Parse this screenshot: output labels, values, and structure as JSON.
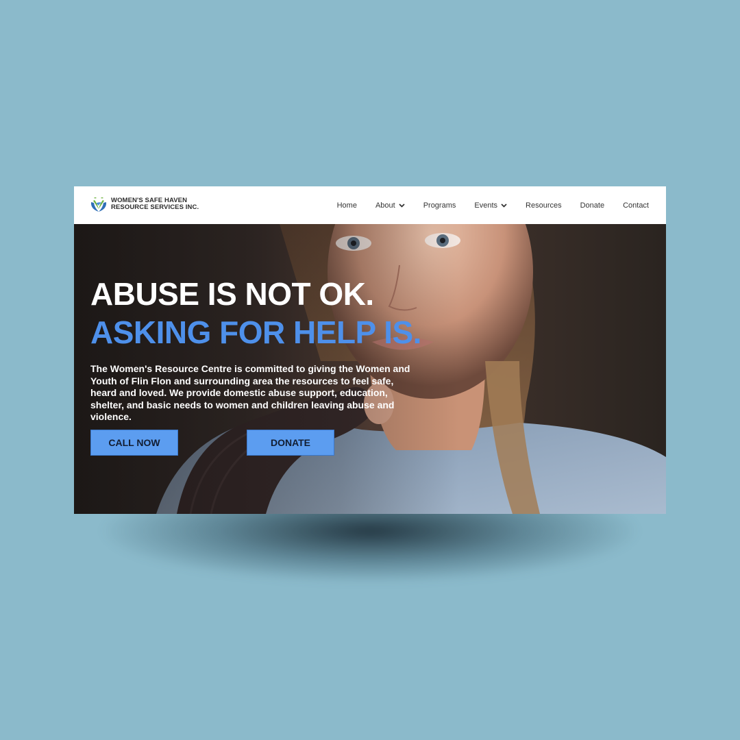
{
  "logo": {
    "line1": "WOMEN'S SAFE HAVEN",
    "line2": "RESOURCE SERVICES INC.",
    "icon": "hands-dove-logo-icon"
  },
  "nav": [
    {
      "label": "Home",
      "has_dropdown": false
    },
    {
      "label": "About",
      "has_dropdown": true
    },
    {
      "label": "Programs",
      "has_dropdown": false
    },
    {
      "label": "Events",
      "has_dropdown": true
    },
    {
      "label": "Resources",
      "has_dropdown": false
    },
    {
      "label": "Donate",
      "has_dropdown": false
    },
    {
      "label": "Contact",
      "has_dropdown": false
    }
  ],
  "hero": {
    "headline_line1": "ABUSE IS NOT OK.",
    "headline_line2": "ASKING FOR HELP IS.",
    "body": "The Women's Resource Centre is committed to giving the Women and Youth of Flin Flon and surrounding area the resources to feel safe, heard and loved.  We provide domestic abuse support, education, shelter, and basic needs to women and children leaving abuse and violence.",
    "call_button": "CALL NOW",
    "donate_button": "DONATE"
  },
  "colors": {
    "page_background": "#8bbacb",
    "accent_blue": "#4e90ea",
    "button_blue": "#5c9df0"
  }
}
